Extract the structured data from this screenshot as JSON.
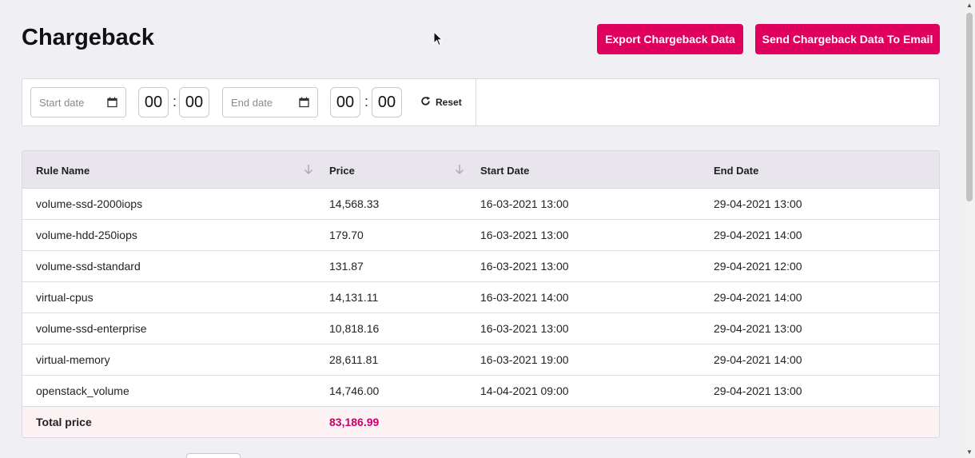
{
  "header": {
    "title": "Chargeback",
    "export_label": "Export Chargeback Data",
    "email_label": "Send Chargeback Data To Email"
  },
  "filters": {
    "start_date_placeholder": "Start date",
    "start_hour": "00",
    "start_minute": "00",
    "end_date_placeholder": "End date",
    "end_hour": "00",
    "end_minute": "00",
    "time_separator": ":",
    "reset_label": "Reset"
  },
  "table": {
    "columns": [
      "Rule Name",
      "Price",
      "Start Date",
      "End Date"
    ],
    "rows": [
      [
        "volume-ssd-2000iops",
        "14,568.33",
        "16-03-2021 13:00",
        "29-04-2021 13:00"
      ],
      [
        "volume-hdd-250iops",
        "179.70",
        "16-03-2021 13:00",
        "29-04-2021 14:00"
      ],
      [
        "volume-ssd-standard",
        "131.87",
        "16-03-2021 13:00",
        "29-04-2021 12:00"
      ],
      [
        "virtual-cpus",
        "14,131.11",
        "16-03-2021 14:00",
        "29-04-2021 14:00"
      ],
      [
        "volume-ssd-enterprise",
        "10,818.16",
        "16-03-2021 13:00",
        "29-04-2021 13:00"
      ],
      [
        "virtual-memory",
        "28,611.81",
        "16-03-2021 19:00",
        "29-04-2021 14:00"
      ],
      [
        "openstack_volume",
        "14,746.00",
        "14-04-2021 09:00",
        "29-04-2021 13:00"
      ]
    ],
    "total_label": "Total price",
    "total_value": "83,186.99"
  },
  "colors": {
    "accent": "#e0005e",
    "total_value": "#c7006a",
    "background": "#f0eff4"
  },
  "icons": [
    "calendar-icon",
    "refresh-icon",
    "sort-arrow-down-icon",
    "mouse-cursor-icon"
  ]
}
